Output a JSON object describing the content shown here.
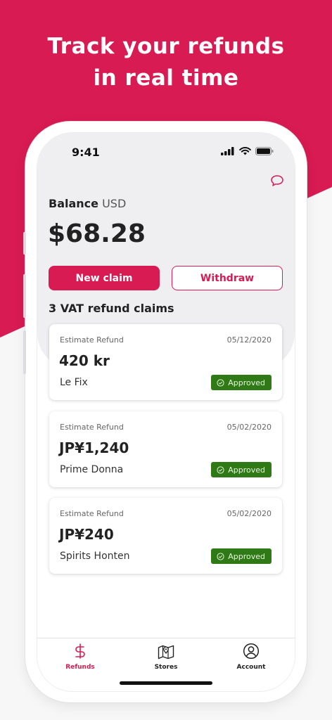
{
  "headline": {
    "line1": "Track your refunds",
    "line2": "in real time"
  },
  "status_bar": {
    "time": "9:41"
  },
  "balance": {
    "label": "Balance",
    "currency": "USD",
    "value": "$68.28"
  },
  "actions": {
    "new_claim": "New claim",
    "withdraw": "Withdraw"
  },
  "claims_title": "3 VAT refund claims",
  "claims": [
    {
      "label": "Estimate Refund",
      "date": "05/12/2020",
      "amount": "420 kr",
      "store": "Le Fix",
      "status": "Approved"
    },
    {
      "label": "Estimate Refund",
      "date": "05/02/2020",
      "amount": "JP¥1,240",
      "store": "Prime Donna",
      "status": "Approved"
    },
    {
      "label": "Estimate Refund",
      "date": "05/02/2020",
      "amount": "JP¥240",
      "store": "Spirits Honten",
      "status": "Approved"
    }
  ],
  "tabs": [
    {
      "label": "Refunds",
      "icon": "dollar-icon",
      "active": true
    },
    {
      "label": "Stores",
      "icon": "map-icon",
      "active": false
    },
    {
      "label": "Account",
      "icon": "user-icon",
      "active": false
    }
  ],
  "colors": {
    "brand": "#d81b52",
    "approved": "#2f7a16"
  }
}
